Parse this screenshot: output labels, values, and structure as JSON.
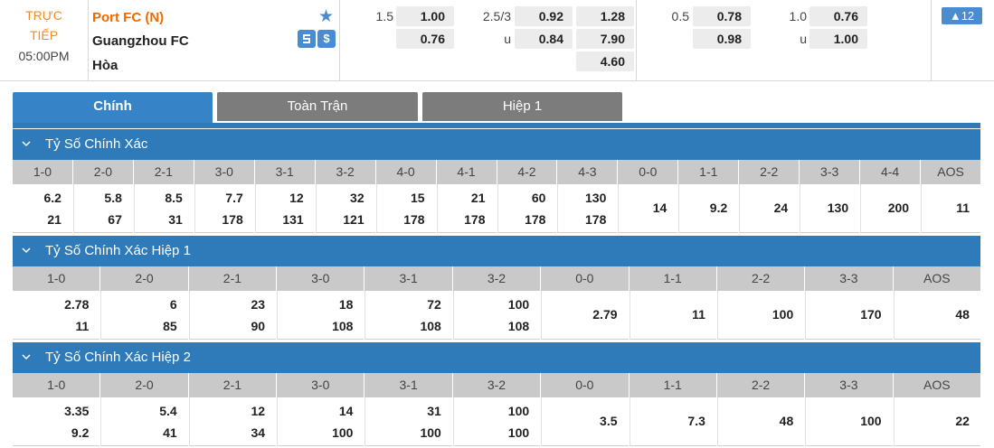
{
  "match": {
    "status_line1": "TRỰC",
    "status_line2": "TIẾP",
    "kickoff": "05:00PM",
    "home": "Port FC (N)",
    "away": "Guangzhou FC",
    "draw": "Hòa",
    "more_count": "▲12",
    "icons": {
      "star": "star-icon",
      "stats": "stats-icon",
      "money": "money-icon"
    },
    "ft_handicap": {
      "line": "1.5",
      "home": "1.00",
      "away": "0.76"
    },
    "ft_total": {
      "line": "2.5/3",
      "over": "0.92",
      "under_label": "u",
      "under": "0.84"
    },
    "ft_1x2": {
      "home": "1.28",
      "away": "7.90",
      "draw": "4.60"
    },
    "h1_handicap": {
      "line": "0.5",
      "home": "0.78",
      "away": "0.98"
    },
    "h1_total": {
      "line": "1.0",
      "over": "0.76",
      "under_label": "u",
      "under": "1.00"
    }
  },
  "tabs": [
    {
      "label": "Chính",
      "active": true
    },
    {
      "label": "Toàn Trận",
      "active": false
    },
    {
      "label": "Hiệp 1",
      "active": false
    }
  ],
  "sections": [
    {
      "title": "Tỷ Số Chính Xác",
      "cols": [
        {
          "h": "1-0",
          "v1": "6.2",
          "v2": "21"
        },
        {
          "h": "2-0",
          "v1": "5.8",
          "v2": "67"
        },
        {
          "h": "2-1",
          "v1": "8.5",
          "v2": "31"
        },
        {
          "h": "3-0",
          "v1": "7.7",
          "v2": "178"
        },
        {
          "h": "3-1",
          "v1": "12",
          "v2": "131"
        },
        {
          "h": "3-2",
          "v1": "32",
          "v2": "121"
        },
        {
          "h": "4-0",
          "v1": "15",
          "v2": "178"
        },
        {
          "h": "4-1",
          "v1": "21",
          "v2": "178"
        },
        {
          "h": "4-2",
          "v1": "60",
          "v2": "178"
        },
        {
          "h": "4-3",
          "v1": "130",
          "v2": "178"
        },
        {
          "h": "0-0",
          "v": "14"
        },
        {
          "h": "1-1",
          "v": "9.2"
        },
        {
          "h": "2-2",
          "v": "24"
        },
        {
          "h": "3-3",
          "v": "130"
        },
        {
          "h": "4-4",
          "v": "200"
        },
        {
          "h": "AOS",
          "v": "11"
        }
      ]
    },
    {
      "title": "Tỷ Số Chính Xác Hiệp 1",
      "cols": [
        {
          "h": "1-0",
          "v1": "2.78",
          "v2": "11"
        },
        {
          "h": "2-0",
          "v1": "6",
          "v2": "85"
        },
        {
          "h": "2-1",
          "v1": "23",
          "v2": "90"
        },
        {
          "h": "3-0",
          "v1": "18",
          "v2": "108"
        },
        {
          "h": "3-1",
          "v1": "72",
          "v2": "108"
        },
        {
          "h": "3-2",
          "v1": "100",
          "v2": "108"
        },
        {
          "h": "0-0",
          "v": "2.79"
        },
        {
          "h": "1-1",
          "v": "11"
        },
        {
          "h": "2-2",
          "v": "100"
        },
        {
          "h": "3-3",
          "v": "170"
        },
        {
          "h": "AOS",
          "v": "48"
        }
      ]
    },
    {
      "title": "Tỷ Số Chính Xác Hiệp 2",
      "cols": [
        {
          "h": "1-0",
          "v1": "3.35",
          "v2": "9.2"
        },
        {
          "h": "2-0",
          "v1": "5.4",
          "v2": "41"
        },
        {
          "h": "2-1",
          "v1": "12",
          "v2": "34"
        },
        {
          "h": "3-0",
          "v1": "14",
          "v2": "100"
        },
        {
          "h": "3-1",
          "v1": "31",
          "v2": "100"
        },
        {
          "h": "3-2",
          "v1": "100",
          "v2": "100"
        },
        {
          "h": "0-0",
          "v": "3.5"
        },
        {
          "h": "1-1",
          "v": "7.3"
        },
        {
          "h": "2-2",
          "v": "48"
        },
        {
          "h": "3-3",
          "v": "100"
        },
        {
          "h": "AOS",
          "v": "22"
        }
      ]
    }
  ]
}
